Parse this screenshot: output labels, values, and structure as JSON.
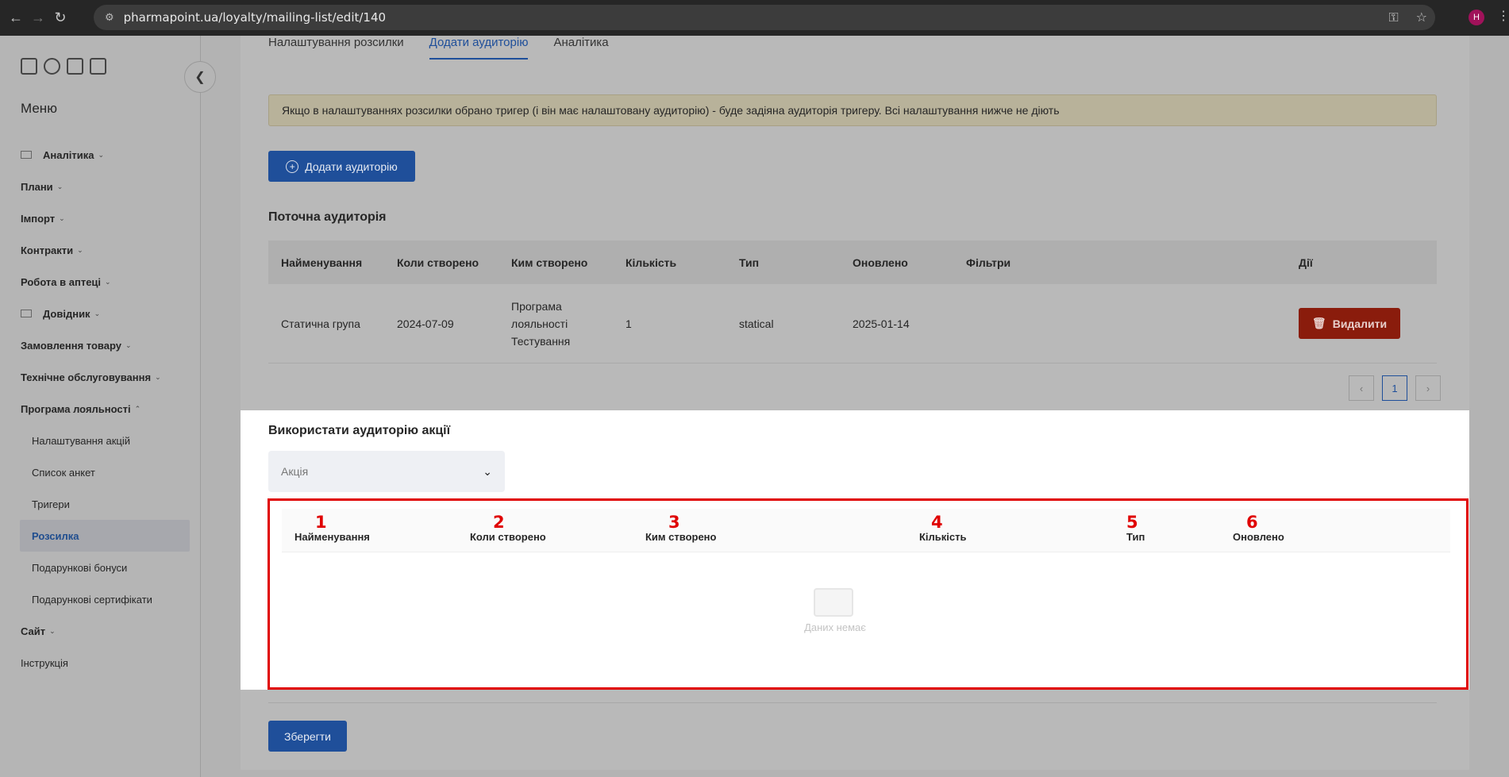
{
  "browser": {
    "url": "pharmapoint.ua/loyalty/mailing-list/edit/140",
    "avatar_letter": "H"
  },
  "sidebar": {
    "menu_title": "Меню",
    "items": [
      {
        "label": "Аналітика",
        "icon": "grid-icon",
        "chevron": "⌄"
      },
      {
        "label": "Плани",
        "chevron": "⌄"
      },
      {
        "label": "Імпорт",
        "chevron": "⌄"
      },
      {
        "label": "Контракти",
        "chevron": "⌄"
      },
      {
        "label": "Робота в аптеці",
        "chevron": "⌄"
      },
      {
        "label": "Довідник",
        "icon": "list-icon",
        "chevron": "⌄"
      },
      {
        "label": "Замовлення товару",
        "chevron": "⌄"
      },
      {
        "label": "Технічне обслуговування",
        "chevron": "⌄"
      },
      {
        "label": "Програма лояльності",
        "chevron": "⌃"
      }
    ],
    "subitems": [
      {
        "label": "Налаштування акцій"
      },
      {
        "label": "Список анкет"
      },
      {
        "label": "Тригери"
      },
      {
        "label": "Розсилка",
        "active": true
      },
      {
        "label": "Подарункові бонуси"
      },
      {
        "label": "Подарункові сертифікати"
      }
    ],
    "after": [
      {
        "label": "Сайт",
        "chevron": "⌄"
      },
      {
        "label": "Інструкція"
      }
    ]
  },
  "tabs": [
    "Налаштування розсилки",
    "Додати аудиторію",
    "Аналітика"
  ],
  "alert": "Якщо в налаштуваннях розсилки обрано тригер (і він має налаштовану аудиторію) - буде задіяна аудиторія тригеру. Всі налаштування нижче не діють",
  "add_audience_button": "Додати аудиторію",
  "current_audience": {
    "title": "Поточна аудиторія",
    "columns": [
      "Найменування",
      "Коли створено",
      "Ким створено",
      "Кількість",
      "Тип",
      "Оновлено",
      "Фільтри",
      "Дії"
    ],
    "rows": [
      {
        "name": "Статична група",
        "created": "2024-07-09",
        "author_1": "Програма",
        "author_2": "лояльності",
        "author_3": "Тестування",
        "count": "1",
        "type": "statical",
        "updated": "2025-01-14",
        "filters": "",
        "action": "Видалити"
      }
    ],
    "pagination": {
      "current": "1"
    }
  },
  "promo_audience": {
    "title": "Використати аудиторію акції",
    "select_placeholder": "Акція",
    "columns": [
      "Найменування",
      "Коли створено",
      "Ким створено",
      "Кількість",
      "Тип",
      "Оновлено"
    ],
    "markers": [
      "1",
      "2",
      "3",
      "4",
      "5",
      "6"
    ],
    "empty_text": "Даних немає"
  },
  "save_button": "Зберегти",
  "colors": {
    "primary": "#1f4f9a",
    "danger": "#b3260f",
    "highlight_border": "#e00000"
  }
}
